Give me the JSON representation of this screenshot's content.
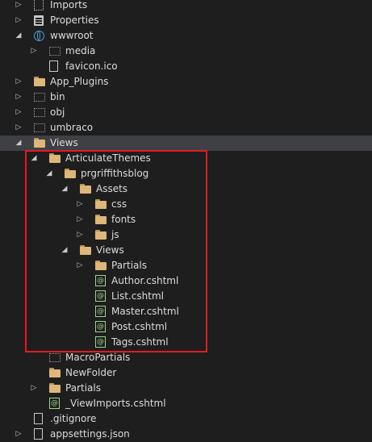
{
  "tree": [
    {
      "label": "Imports",
      "level": 0,
      "arrow": "collapsed",
      "icon": "imports-icon"
    },
    {
      "label": "Properties",
      "level": 0,
      "arrow": "collapsed",
      "icon": "properties-icon"
    },
    {
      "label": "wwwroot",
      "level": 0,
      "arrow": "expanded",
      "icon": "globe-icon"
    },
    {
      "label": "media",
      "level": 1,
      "arrow": "collapsed",
      "icon": "ghost-folder-icon"
    },
    {
      "label": "favicon.ico",
      "level": 1,
      "arrow": "none",
      "icon": "file-icon"
    },
    {
      "label": "App_Plugins",
      "level": 0,
      "arrow": "collapsed",
      "icon": "folder-icon"
    },
    {
      "label": "bin",
      "level": 0,
      "arrow": "collapsed",
      "icon": "ghost-folder-icon"
    },
    {
      "label": "obj",
      "level": 0,
      "arrow": "collapsed",
      "icon": "ghost-folder-icon"
    },
    {
      "label": "umbraco",
      "level": 0,
      "arrow": "collapsed",
      "icon": "ghost-folder-icon"
    },
    {
      "label": "Views",
      "level": 0,
      "arrow": "expanded",
      "icon": "folder-icon",
      "selected": true
    },
    {
      "label": "ArticulateThemes",
      "level": 1,
      "arrow": "expanded",
      "icon": "folder-icon"
    },
    {
      "label": "prgriffithsblog",
      "level": 2,
      "arrow": "expanded",
      "icon": "folder-icon"
    },
    {
      "label": "Assets",
      "level": 3,
      "arrow": "expanded",
      "icon": "folder-icon"
    },
    {
      "label": "css",
      "level": 4,
      "arrow": "collapsed",
      "icon": "folder-icon"
    },
    {
      "label": "fonts",
      "level": 4,
      "arrow": "collapsed",
      "icon": "folder-icon"
    },
    {
      "label": "js",
      "level": 4,
      "arrow": "collapsed",
      "icon": "folder-icon"
    },
    {
      "label": "Views",
      "level": 3,
      "arrow": "expanded",
      "icon": "folder-icon"
    },
    {
      "label": "Partials",
      "level": 4,
      "arrow": "collapsed",
      "icon": "folder-icon"
    },
    {
      "label": "Author.cshtml",
      "level": 4,
      "arrow": "none",
      "icon": "razor-file-icon"
    },
    {
      "label": "List.cshtml",
      "level": 4,
      "arrow": "none",
      "icon": "razor-file-icon"
    },
    {
      "label": "Master.cshtml",
      "level": 4,
      "arrow": "none",
      "icon": "razor-file-icon"
    },
    {
      "label": "Post.cshtml",
      "level": 4,
      "arrow": "none",
      "icon": "razor-file-icon"
    },
    {
      "label": "Tags.cshtml",
      "level": 4,
      "arrow": "none",
      "icon": "razor-file-icon"
    },
    {
      "label": "MacroPartials",
      "level": 1,
      "arrow": "none",
      "icon": "ghost-folder-icon"
    },
    {
      "label": "NewFolder",
      "level": 1,
      "arrow": "none",
      "icon": "folder-icon"
    },
    {
      "label": "Partials",
      "level": 1,
      "arrow": "collapsed",
      "icon": "folder-icon"
    },
    {
      "label": "_ViewImports.cshtml",
      "level": 1,
      "arrow": "none",
      "icon": "razor-file-icon"
    },
    {
      "label": ".gitignore",
      "level": 0,
      "arrow": "none",
      "icon": "file-icon"
    },
    {
      "label": "appsettings.json",
      "level": 0,
      "arrow": "collapsed",
      "icon": "file-icon"
    }
  ],
  "glyphs": {
    "collapsed": "▷",
    "expanded": "◢",
    "razor": "@"
  },
  "colors": {
    "background": "#1e1e1e",
    "selected_row": "#3f3f46",
    "folder": "#dcb67a",
    "highlight_box": "#e31b23"
  }
}
